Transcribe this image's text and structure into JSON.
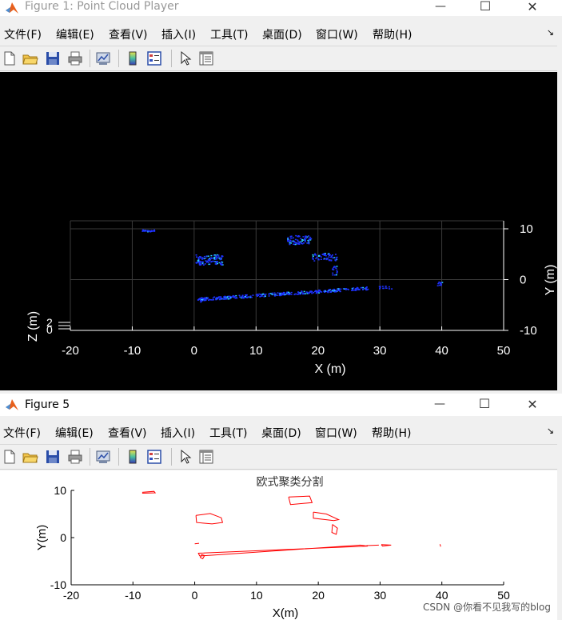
{
  "figure1": {
    "title": "Figure 1: Point Cloud Player",
    "menu": [
      "文件(F)",
      "编辑(E)",
      "查看(V)",
      "插入(I)",
      "工具(T)",
      "桌面(D)",
      "窗口(W)",
      "帮助(H)"
    ],
    "controls": {
      "minimize": "—",
      "maximize": "☐",
      "close": "✕"
    },
    "plot": {
      "xlabel": "X (m)",
      "ylabel": "Y (m)",
      "zlabel": "Z (m)",
      "x_ticks": [
        "-20",
        "-10",
        "0",
        "10",
        "20",
        "30",
        "40",
        "50"
      ],
      "y_ticks": [
        "10",
        "0",
        "-10"
      ],
      "z_ticks": [
        "2",
        "0"
      ],
      "xlim": [
        -20,
        50
      ],
      "ylim": [
        -10,
        10
      ],
      "colors": {
        "background": "#000000",
        "points": "#1e32ff",
        "highlight": "#29d6ff",
        "axis": "#ffffff",
        "grid": "#3a3a3a"
      }
    }
  },
  "figure5": {
    "title": "Figure 5",
    "menu": [
      "文件(F)",
      "编辑(E)",
      "查看(V)",
      "插入(I)",
      "工具(T)",
      "桌面(D)",
      "窗口(W)",
      "帮助(H)"
    ],
    "controls": {
      "minimize": "—",
      "maximize": "☐",
      "close": "✕"
    }
  },
  "watermark": "CSDN @你看不见我写的blog",
  "chart_data": {
    "type": "line",
    "title": "欧式聚类分割",
    "xlabel": "X(m)",
    "ylabel": "Y(m)",
    "xlim": [
      -20,
      50
    ],
    "ylim": [
      -10,
      10
    ],
    "x_ticks": [
      -20,
      -10,
      0,
      10,
      20,
      30,
      40,
      50
    ],
    "y_ticks": [
      10,
      0,
      -10
    ],
    "grid": false,
    "color": "#ff0000",
    "series": [
      {
        "x": [
          -8.5,
          -6.6,
          -6.4,
          -8.5
        ],
        "y": [
          9.6,
          9.8,
          9.5,
          9.4
        ]
      },
      {
        "x": [
          15.2,
          18.6,
          19.0,
          15.5,
          15.2
        ],
        "y": [
          8.6,
          8.8,
          7.4,
          7.0,
          8.6
        ]
      },
      {
        "x": [
          0.2,
          2.5,
          4.3,
          4.5,
          2.8,
          0.3,
          0.2
        ],
        "y": [
          4.7,
          5.1,
          4.2,
          3.2,
          2.9,
          3.2,
          4.7
        ]
      },
      {
        "x": [
          19.2,
          21.3,
          23.3,
          22.5,
          19.2,
          19.2
        ],
        "y": [
          5.4,
          5.0,
          3.8,
          3.6,
          4.1,
          5.4
        ]
      },
      {
        "x": [
          22.3,
          23.1,
          22.9,
          22.2,
          22.3
        ],
        "y": [
          2.8,
          2.0,
          0.7,
          1.1,
          2.8
        ]
      },
      {
        "x": [
          0.8,
          26.8,
          28.0,
          0.6,
          0.8
        ],
        "y": [
          -3.9,
          -1.6,
          -1.8,
          -3.3,
          -3.9
        ]
      },
      {
        "x": [
          1.1,
          1.6,
          1.3,
          0.9,
          1.1
        ],
        "y": [
          -3.6,
          -3.8,
          -4.5,
          -4.2,
          -3.6
        ]
      },
      {
        "x": [
          0.0,
          0.7
        ],
        "y": [
          -1.3,
          -1.2
        ]
      },
      {
        "x": [
          27.8,
          29.8
        ],
        "y": [
          -1.7,
          -1.6
        ]
      },
      {
        "x": [
          30.2,
          31.8,
          30.4,
          30.2
        ],
        "y": [
          -1.5,
          -1.6,
          -1.8,
          -1.5
        ]
      },
      {
        "x": [
          39.7,
          39.8
        ],
        "y": [
          -1.4,
          -1.9
        ]
      }
    ]
  }
}
